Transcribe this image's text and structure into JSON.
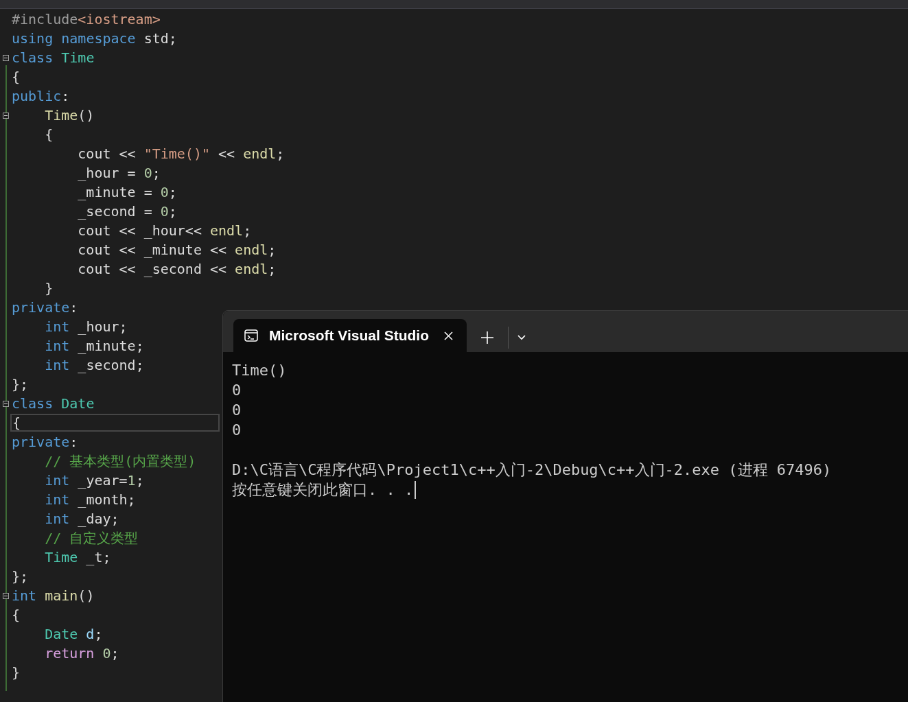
{
  "editor": {
    "lines": [
      {
        "fold": false,
        "current": false,
        "tokens": [
          {
            "kind": "pre",
            "text": "#include"
          },
          {
            "kind": "str",
            "text": "<iostream>"
          }
        ]
      },
      {
        "fold": false,
        "current": false,
        "tokens": [
          {
            "kind": "kw",
            "text": "using"
          },
          {
            "kind": "kw",
            "text": " namespace"
          },
          {
            "kind": "plain",
            "text": " std;"
          }
        ]
      },
      {
        "fold": true,
        "current": false,
        "tokens": [
          {
            "kind": "kw",
            "text": "class"
          },
          {
            "kind": "type",
            "text": " Time"
          }
        ]
      },
      {
        "fold": false,
        "current": false,
        "tokens": [
          {
            "kind": "plain",
            "text": "{"
          }
        ]
      },
      {
        "fold": false,
        "current": false,
        "tokens": [
          {
            "kind": "kw",
            "text": "public"
          },
          {
            "kind": "plain",
            "text": ":"
          }
        ]
      },
      {
        "fold": true,
        "current": false,
        "tokens": [
          {
            "kind": "fn",
            "text": "    Time"
          },
          {
            "kind": "plain",
            "text": "()"
          }
        ]
      },
      {
        "fold": false,
        "current": false,
        "tokens": [
          {
            "kind": "plain",
            "text": "    {"
          }
        ]
      },
      {
        "fold": false,
        "current": false,
        "tokens": [
          {
            "kind": "plain",
            "text": "        cout << "
          },
          {
            "kind": "str",
            "text": "\"Time()\""
          },
          {
            "kind": "plain",
            "text": " << "
          },
          {
            "kind": "fn",
            "text": "endl"
          },
          {
            "kind": "plain",
            "text": ";"
          }
        ]
      },
      {
        "fold": false,
        "current": false,
        "tokens": [
          {
            "kind": "plain",
            "text": "        _hour = "
          },
          {
            "kind": "num",
            "text": "0"
          },
          {
            "kind": "plain",
            "text": ";"
          }
        ]
      },
      {
        "fold": false,
        "current": false,
        "tokens": [
          {
            "kind": "plain",
            "text": "        _minute = "
          },
          {
            "kind": "num",
            "text": "0"
          },
          {
            "kind": "plain",
            "text": ";"
          }
        ]
      },
      {
        "fold": false,
        "current": false,
        "tokens": [
          {
            "kind": "plain",
            "text": "        _second = "
          },
          {
            "kind": "num",
            "text": "0"
          },
          {
            "kind": "plain",
            "text": ";"
          }
        ]
      },
      {
        "fold": false,
        "current": false,
        "tokens": [
          {
            "kind": "plain",
            "text": "        cout << _hour<< "
          },
          {
            "kind": "fn",
            "text": "endl"
          },
          {
            "kind": "plain",
            "text": ";"
          }
        ]
      },
      {
        "fold": false,
        "current": false,
        "tokens": [
          {
            "kind": "plain",
            "text": "        cout << _minute << "
          },
          {
            "kind": "fn",
            "text": "endl"
          },
          {
            "kind": "plain",
            "text": ";"
          }
        ]
      },
      {
        "fold": false,
        "current": false,
        "tokens": [
          {
            "kind": "plain",
            "text": "        cout << _second << "
          },
          {
            "kind": "fn",
            "text": "endl"
          },
          {
            "kind": "plain",
            "text": ";"
          }
        ]
      },
      {
        "fold": false,
        "current": false,
        "tokens": [
          {
            "kind": "plain",
            "text": "    }"
          }
        ]
      },
      {
        "fold": false,
        "current": false,
        "tokens": [
          {
            "kind": "kw",
            "text": "private"
          },
          {
            "kind": "plain",
            "text": ":"
          }
        ]
      },
      {
        "fold": false,
        "current": false,
        "tokens": [
          {
            "kind": "kw",
            "text": "    int"
          },
          {
            "kind": "plain",
            "text": " _hour;"
          }
        ]
      },
      {
        "fold": false,
        "current": false,
        "tokens": [
          {
            "kind": "kw",
            "text": "    int"
          },
          {
            "kind": "plain",
            "text": " _minute;"
          }
        ]
      },
      {
        "fold": false,
        "current": false,
        "tokens": [
          {
            "kind": "kw",
            "text": "    int"
          },
          {
            "kind": "plain",
            "text": " _second;"
          }
        ]
      },
      {
        "fold": false,
        "current": false,
        "tokens": [
          {
            "kind": "plain",
            "text": "};"
          }
        ]
      },
      {
        "fold": true,
        "current": false,
        "tokens": [
          {
            "kind": "kw",
            "text": "class"
          },
          {
            "kind": "type",
            "text": " Date"
          }
        ]
      },
      {
        "fold": false,
        "current": true,
        "tokens": [
          {
            "kind": "plain",
            "text": "{"
          }
        ]
      },
      {
        "fold": false,
        "current": false,
        "tokens": [
          {
            "kind": "kw",
            "text": "private"
          },
          {
            "kind": "plain",
            "text": ":"
          }
        ]
      },
      {
        "fold": false,
        "current": false,
        "tokens": [
          {
            "kind": "cmt",
            "text": "    // 基本类型(内置类型)"
          }
        ]
      },
      {
        "fold": false,
        "current": false,
        "tokens": [
          {
            "kind": "kw",
            "text": "    int"
          },
          {
            "kind": "plain",
            "text": " _year="
          },
          {
            "kind": "num",
            "text": "1"
          },
          {
            "kind": "plain",
            "text": ";"
          }
        ]
      },
      {
        "fold": false,
        "current": false,
        "tokens": [
          {
            "kind": "kw",
            "text": "    int"
          },
          {
            "kind": "plain",
            "text": " _month;"
          }
        ]
      },
      {
        "fold": false,
        "current": false,
        "tokens": [
          {
            "kind": "kw",
            "text": "    int"
          },
          {
            "kind": "plain",
            "text": " _day;"
          }
        ]
      },
      {
        "fold": false,
        "current": false,
        "tokens": [
          {
            "kind": "cmt",
            "text": "    // 自定义类型"
          }
        ]
      },
      {
        "fold": false,
        "current": false,
        "tokens": [
          {
            "kind": "type",
            "text": "    Time"
          },
          {
            "kind": "plain",
            "text": " _t;"
          }
        ]
      },
      {
        "fold": false,
        "current": false,
        "tokens": [
          {
            "kind": "plain",
            "text": "};"
          }
        ]
      },
      {
        "fold": true,
        "current": false,
        "tokens": [
          {
            "kind": "kw",
            "text": "int"
          },
          {
            "kind": "fn",
            "text": " main"
          },
          {
            "kind": "plain",
            "text": "()"
          }
        ]
      },
      {
        "fold": false,
        "current": false,
        "tokens": [
          {
            "kind": "plain",
            "text": "{"
          }
        ]
      },
      {
        "fold": false,
        "current": false,
        "tokens": [
          {
            "kind": "type",
            "text": "    Date"
          },
          {
            "kind": "var",
            "text": " d"
          },
          {
            "kind": "plain",
            "text": ";"
          }
        ]
      },
      {
        "fold": false,
        "current": false,
        "tokens": [
          {
            "kind": "ctl",
            "text": "    return"
          },
          {
            "kind": "num",
            "text": " 0"
          },
          {
            "kind": "plain",
            "text": ";"
          }
        ]
      },
      {
        "fold": false,
        "current": false,
        "tokens": [
          {
            "kind": "plain",
            "text": "}"
          }
        ]
      }
    ]
  },
  "terminal": {
    "tab": {
      "title": "Microsoft Visual Studio",
      "selected": true
    },
    "output": [
      [
        "Time()",
        "0",
        "0",
        "0"
      ],
      [
        "D:\\C语言\\C程序代码\\Project1\\c++入门-2\\Debug\\c++入门-2.exe (进程 67496)",
        "按任意键关闭此窗口. . ."
      ]
    ]
  }
}
